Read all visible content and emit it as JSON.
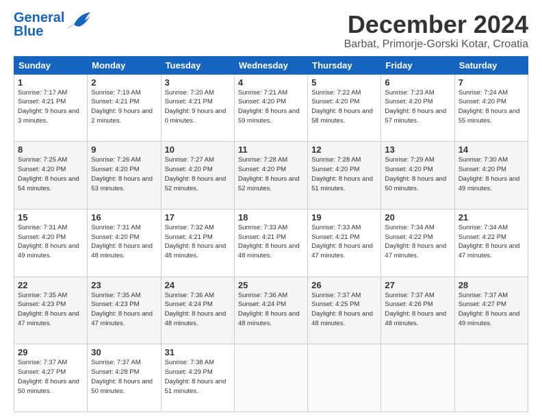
{
  "logo": {
    "line1": "General",
    "line2": "Blue"
  },
  "title": "December 2024",
  "location": "Barbat, Primorje-Gorski Kotar, Croatia",
  "headers": [
    "Sunday",
    "Monday",
    "Tuesday",
    "Wednesday",
    "Thursday",
    "Friday",
    "Saturday"
  ],
  "weeks": [
    [
      {
        "day": "1",
        "sunrise": "7:17 AM",
        "sunset": "4:21 PM",
        "daylight": "9 hours and 3 minutes."
      },
      {
        "day": "2",
        "sunrise": "7:19 AM",
        "sunset": "4:21 PM",
        "daylight": "9 hours and 2 minutes."
      },
      {
        "day": "3",
        "sunrise": "7:20 AM",
        "sunset": "4:21 PM",
        "daylight": "9 hours and 0 minutes."
      },
      {
        "day": "4",
        "sunrise": "7:21 AM",
        "sunset": "4:20 PM",
        "daylight": "8 hours and 59 minutes."
      },
      {
        "day": "5",
        "sunrise": "7:22 AM",
        "sunset": "4:20 PM",
        "daylight": "8 hours and 58 minutes."
      },
      {
        "day": "6",
        "sunrise": "7:23 AM",
        "sunset": "4:20 PM",
        "daylight": "8 hours and 57 minutes."
      },
      {
        "day": "7",
        "sunrise": "7:24 AM",
        "sunset": "4:20 PM",
        "daylight": "8 hours and 55 minutes."
      }
    ],
    [
      {
        "day": "8",
        "sunrise": "7:25 AM",
        "sunset": "4:20 PM",
        "daylight": "8 hours and 54 minutes."
      },
      {
        "day": "9",
        "sunrise": "7:26 AM",
        "sunset": "4:20 PM",
        "daylight": "8 hours and 53 minutes."
      },
      {
        "day": "10",
        "sunrise": "7:27 AM",
        "sunset": "4:20 PM",
        "daylight": "8 hours and 52 minutes."
      },
      {
        "day": "11",
        "sunrise": "7:28 AM",
        "sunset": "4:20 PM",
        "daylight": "8 hours and 52 minutes."
      },
      {
        "day": "12",
        "sunrise": "7:28 AM",
        "sunset": "4:20 PM",
        "daylight": "8 hours and 51 minutes."
      },
      {
        "day": "13",
        "sunrise": "7:29 AM",
        "sunset": "4:20 PM",
        "daylight": "8 hours and 50 minutes."
      },
      {
        "day": "14",
        "sunrise": "7:30 AM",
        "sunset": "4:20 PM",
        "daylight": "8 hours and 49 minutes."
      }
    ],
    [
      {
        "day": "15",
        "sunrise": "7:31 AM",
        "sunset": "4:20 PM",
        "daylight": "8 hours and 49 minutes."
      },
      {
        "day": "16",
        "sunrise": "7:31 AM",
        "sunset": "4:20 PM",
        "daylight": "8 hours and 48 minutes."
      },
      {
        "day": "17",
        "sunrise": "7:32 AM",
        "sunset": "4:21 PM",
        "daylight": "8 hours and 48 minutes."
      },
      {
        "day": "18",
        "sunrise": "7:33 AM",
        "sunset": "4:21 PM",
        "daylight": "8 hours and 48 minutes."
      },
      {
        "day": "19",
        "sunrise": "7:33 AM",
        "sunset": "4:21 PM",
        "daylight": "8 hours and 47 minutes."
      },
      {
        "day": "20",
        "sunrise": "7:34 AM",
        "sunset": "4:22 PM",
        "daylight": "8 hours and 47 minutes."
      },
      {
        "day": "21",
        "sunrise": "7:34 AM",
        "sunset": "4:22 PM",
        "daylight": "8 hours and 47 minutes."
      }
    ],
    [
      {
        "day": "22",
        "sunrise": "7:35 AM",
        "sunset": "4:23 PM",
        "daylight": "8 hours and 47 minutes."
      },
      {
        "day": "23",
        "sunrise": "7:35 AM",
        "sunset": "4:23 PM",
        "daylight": "8 hours and 47 minutes."
      },
      {
        "day": "24",
        "sunrise": "7:36 AM",
        "sunset": "4:24 PM",
        "daylight": "8 hours and 48 minutes."
      },
      {
        "day": "25",
        "sunrise": "7:36 AM",
        "sunset": "4:24 PM",
        "daylight": "8 hours and 48 minutes."
      },
      {
        "day": "26",
        "sunrise": "7:37 AM",
        "sunset": "4:25 PM",
        "daylight": "8 hours and 48 minutes."
      },
      {
        "day": "27",
        "sunrise": "7:37 AM",
        "sunset": "4:26 PM",
        "daylight": "8 hours and 48 minutes."
      },
      {
        "day": "28",
        "sunrise": "7:37 AM",
        "sunset": "4:27 PM",
        "daylight": "8 hours and 49 minutes."
      }
    ],
    [
      {
        "day": "29",
        "sunrise": "7:37 AM",
        "sunset": "4:27 PM",
        "daylight": "8 hours and 50 minutes."
      },
      {
        "day": "30",
        "sunrise": "7:37 AM",
        "sunset": "4:28 PM",
        "daylight": "8 hours and 50 minutes."
      },
      {
        "day": "31",
        "sunrise": "7:38 AM",
        "sunset": "4:29 PM",
        "daylight": "8 hours and 51 minutes."
      },
      null,
      null,
      null,
      null
    ]
  ]
}
